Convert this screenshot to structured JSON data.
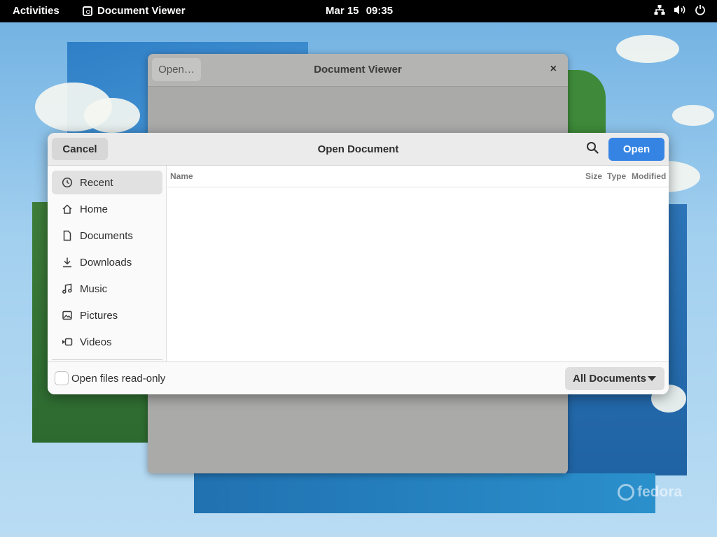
{
  "topbar": {
    "activities": "Activities",
    "app_name": "Document Viewer",
    "clock_date": "Mar 15",
    "clock_time": "09:35",
    "tray_icons": [
      "network-icon",
      "volume-icon",
      "power-icon"
    ]
  },
  "background_window": {
    "title": "Document Viewer",
    "open_button": "Open…",
    "close_symbol": "×"
  },
  "dialog": {
    "title": "Open Document",
    "cancel_label": "Cancel",
    "open_label": "Open",
    "search_icon": "search-icon",
    "sidebar": {
      "items": [
        {
          "label": "Recent",
          "icon": "clock-icon",
          "selected": true
        },
        {
          "label": "Home",
          "icon": "home-icon",
          "selected": false
        },
        {
          "label": "Documents",
          "icon": "document-icon",
          "selected": false
        },
        {
          "label": "Downloads",
          "icon": "download-icon",
          "selected": false
        },
        {
          "label": "Music",
          "icon": "music-icon",
          "selected": false
        },
        {
          "label": "Pictures",
          "icon": "picture-icon",
          "selected": false
        },
        {
          "label": "Videos",
          "icon": "video-icon",
          "selected": false
        }
      ]
    },
    "columns": {
      "name": "Name",
      "size": "Size",
      "type": "Type",
      "modified": "Modified"
    },
    "footer": {
      "readonly_label": "Open files read-only",
      "readonly_checked": false,
      "filter_value": "All Documents"
    }
  },
  "wallpaper": {
    "watermark": "fedora"
  },
  "colors": {
    "accent": "#3584e4",
    "topbar": "#000000"
  }
}
